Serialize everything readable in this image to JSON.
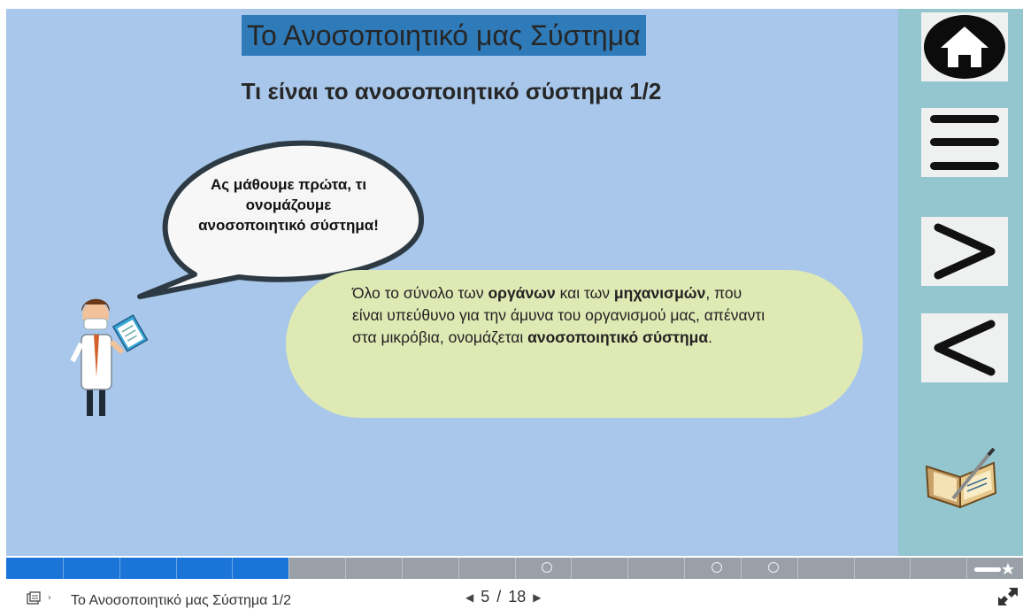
{
  "slide": {
    "title": "Το Ανοσοποιητικό μας Σύστημα",
    "subtitle": "Τι είναι το ανοσοποιητικό σύστημα 1/2",
    "bubble_lines": [
      "Ας μάθουμε πρώτα, τι",
      "ονομάζουμε",
      "ανοσοποιητικό σύστημα!"
    ],
    "info": {
      "t1": "Όλο το σύνολο των ",
      "b1": "οργάνων",
      "t2": " και των ",
      "b2": "μηχανισμών",
      "t3": ", που είναι υπεύθυνο για την άμυνα του οργανισμού μας, απέναντι στα μικρόβια, ονομάζεται ",
      "b3": "ανοσοποιητικό σύστημα",
      "t4": "."
    }
  },
  "sidebar": {
    "icons": [
      "home-icon",
      "menu-icon",
      "next-icon",
      "previous-icon",
      "notebook-icon"
    ]
  },
  "progress": {
    "current": 5,
    "total": 18,
    "fill_fraction": 0.278
  },
  "footer": {
    "breadcrumb_title": "Το Ανοσοποιητικό μας Σύστημα 1/2",
    "current": "5",
    "separator": "/",
    "total": "18"
  },
  "colors": {
    "stage": "#a8c7ea",
    "sidebar": "#94c6cf",
    "title_bg": "#2f7ab8",
    "info_bg": "#dfe9b4",
    "progress_fill": "#1b75d8"
  }
}
